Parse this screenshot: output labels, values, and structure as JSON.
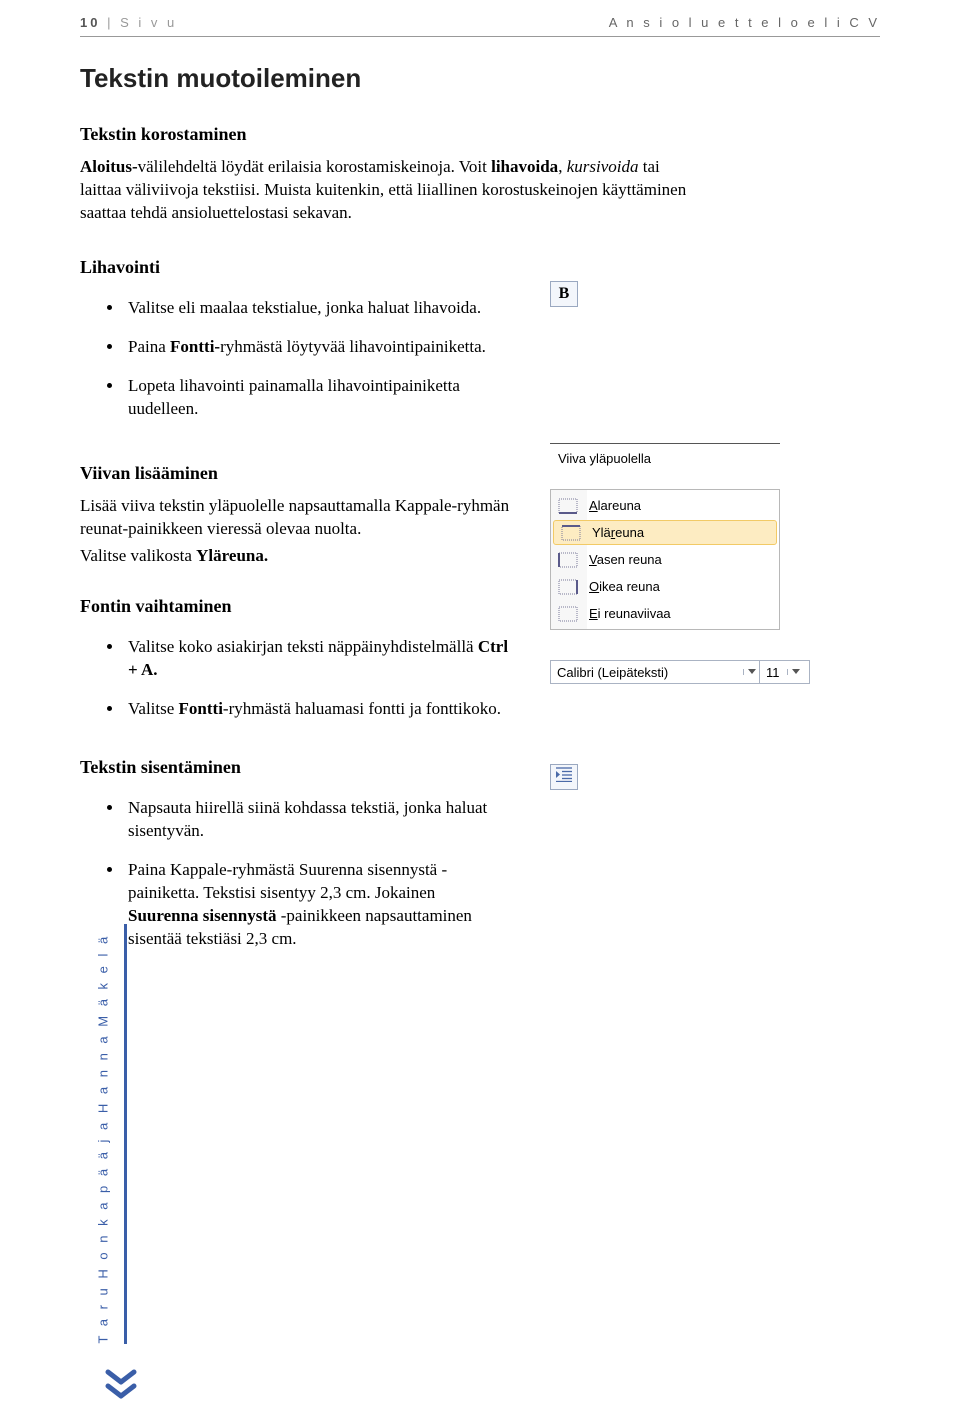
{
  "header": {
    "page_num": "10",
    "page_label": "S i v u",
    "doc_title": "A n s i o l u e t t e l o   e l i   C V"
  },
  "title": "Tekstin muotoileminen",
  "sec_korostaminen": {
    "heading": "Tekstin korostaminen",
    "p1_a": "Aloitus-",
    "p1_b": "välilehdeltä löydät erilaisia korostamiskeinoja. Voit ",
    "p1_c": "lihavoida",
    "p1_d": ", ",
    "p1_e": "kursivoida",
    "p1_f": " tai laittaa väliviivoja tekstiisi. Muista kuitenkin, että liiallinen korostuskeinojen käyttäminen saattaa tehdä ansioluettelostasi sekavan."
  },
  "sec_lihavointi": {
    "heading": "Lihavointi",
    "li1": "Valitse eli maalaa tekstialue, jonka haluat lihavoida.",
    "li2a": "Paina ",
    "li2b": "Fontti-",
    "li2c": "ryhmästä löytyvää lihavointipainiketta.",
    "li3": "Lopeta lihavointi painamalla lihavointipainiketta uudelleen."
  },
  "bold_button": "B",
  "sec_viiva": {
    "heading": "Viivan lisääminen",
    "p1": "Lisää viiva tekstin yläpuolelle napsauttamalla Kappale-ryhmän reunat-painikkeen vieressä olevaa nuolta.",
    "p2a": "Valitse valikosta ",
    "p2b": "Yläreuna."
  },
  "tooltip_text": "Viiva yläpuolella",
  "menu": {
    "items": [
      {
        "pre": "",
        "u": "A",
        "post": "lareuna",
        "sel": false,
        "kind": "bottom"
      },
      {
        "pre": "Ylä",
        "u": "r",
        "post": "euna",
        "sel": true,
        "kind": "top"
      },
      {
        "pre": "",
        "u": "V",
        "post": "asen reuna",
        "sel": false,
        "kind": "left"
      },
      {
        "pre": "",
        "u": "O",
        "post": "ikea reuna",
        "sel": false,
        "kind": "right"
      },
      {
        "pre": "",
        "u": "E",
        "post": "i reunaviivaa",
        "sel": false,
        "kind": "none"
      }
    ]
  },
  "sec_fontti": {
    "heading": "Fontin vaihtaminen",
    "li1a": "Valitse koko asiakirjan teksti näppäinyhdistelmällä  ",
    "li1b": "Ctrl + A.",
    "li2a": "Valitse ",
    "li2b": "Fontti",
    "li2c": "-ryhmästä haluamasi fontti ja fonttikoko."
  },
  "font_combo": {
    "font_name": "Calibri (Leipäteksti)",
    "font_size": "11"
  },
  "sec_sisennys": {
    "heading": "Tekstin sisentäminen",
    "li1": "Napsauta hiirellä siinä kohdassa tekstiä, jonka haluat sisentyvän.",
    "li2a": "Paina Kappale-ryhmästä Suurenna sisennystä -painiketta. Tekstisi sisentyy 2,3 cm. Jokainen ",
    "li2b": "Suurenna sisennystä ",
    "li2c": "-painikkeen napsauttaminen sisentää tekstiäsi 2,3 cm."
  },
  "sidebar_author": "T a r u   H o n k a p ä ä   j a   H a n n a   M ä k e l ä",
  "colors": {
    "accent": "#3a5ea8",
    "menu_sel_bg": "#fdecc2",
    "menu_sel_border": "#f2ca66"
  }
}
